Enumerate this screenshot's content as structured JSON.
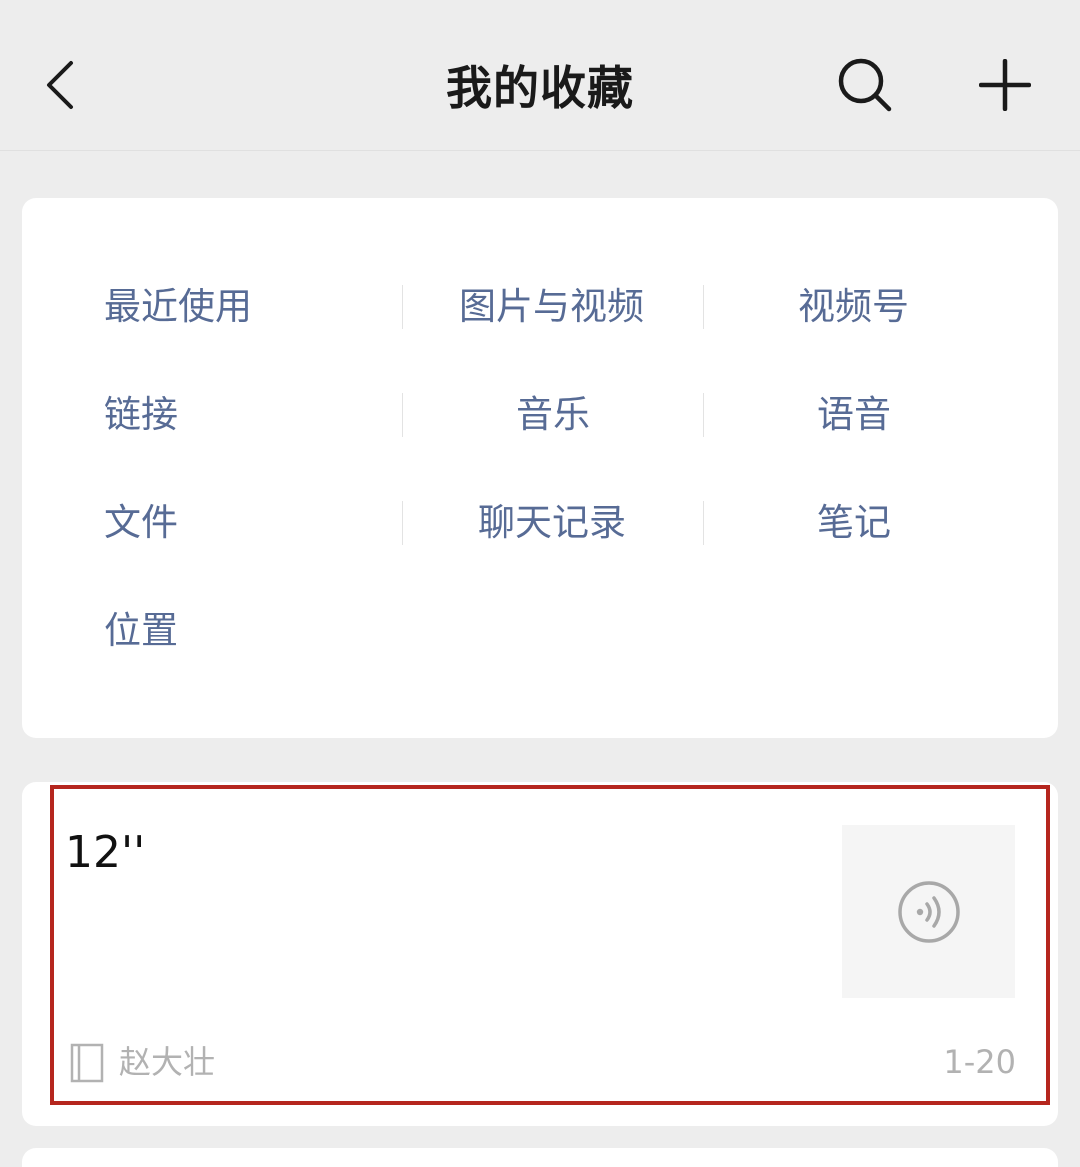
{
  "header": {
    "title": "我的收藏",
    "back_icon": "chevron-left-icon",
    "search_icon": "search-icon",
    "add_icon": "plus-icon"
  },
  "categories": [
    {
      "label": "最近使用"
    },
    {
      "label": "图片与视频"
    },
    {
      "label": "视频号"
    },
    {
      "label": "链接"
    },
    {
      "label": "音乐"
    },
    {
      "label": "语音"
    },
    {
      "label": "文件"
    },
    {
      "label": "聊天记录"
    },
    {
      "label": "笔记"
    },
    {
      "label": "位置"
    }
  ],
  "favorite_item": {
    "title": "12''",
    "type_icon": "voice-icon",
    "source_icon": "note-icon",
    "source": "赵大壮",
    "date": "1-20"
  },
  "colors": {
    "background": "#ededed",
    "link": "#576b95",
    "highlight": "#b5261e",
    "meta_text": "#b2b2b2"
  }
}
